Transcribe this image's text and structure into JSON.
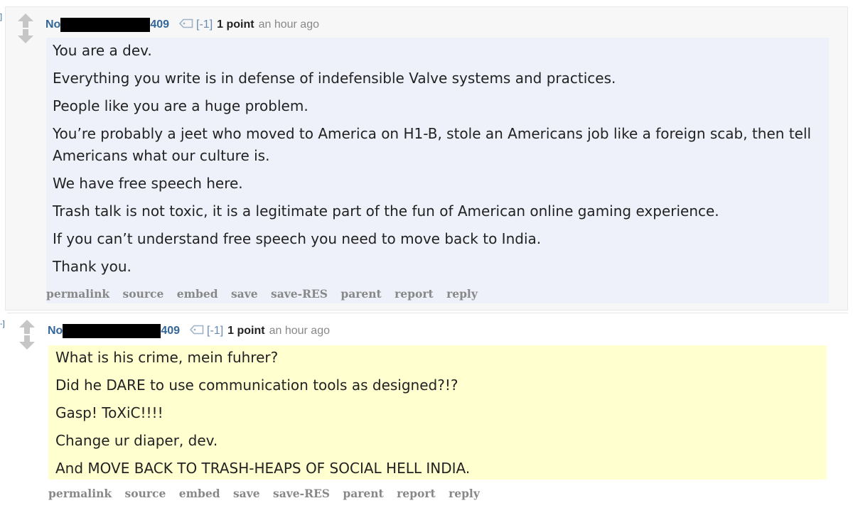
{
  "comments": [
    {
      "gutter": "]",
      "author_prefix": "No",
      "author_suffix": "409",
      "flair": "[-1]",
      "score": "1 point",
      "time": "an hour ago",
      "paragraphs": [
        "You are a dev.",
        "Everything you write is in defense of indefensible Valve systems and practices.",
        "People like you are a huge problem.",
        "You’re probably a jeet who moved to America on H1-B, stole an Americans job like a foreign scab, then tell Americans what our culture is.",
        "We have free speech here.",
        "Trash talk is not toxic, it is a  legitimate part of the fun of American online gaming experience.",
        "If you can’t understand free speech you need to move back to India.",
        "Thank you."
      ],
      "buttons": [
        "permalink",
        "source",
        "embed",
        "save",
        "save-RES",
        "parent",
        "report",
        "reply"
      ],
      "body_bg": "#eef1f9"
    },
    {
      "gutter": "-]",
      "author_prefix": "No",
      "author_suffix": "409",
      "flair": "[-1]",
      "score": "1 point",
      "time": "an hour ago",
      "paragraphs": [
        "What is his crime, mein fuhrer?",
        "Did he DARE to use communication tools as designed?!?",
        "Gasp! ToXiC!!!!",
        "Change ur diaper, dev.",
        "And MOVE BACK TO TRASH-HEAPS OF SOCIAL HELL INDIA."
      ],
      "buttons": [
        "permalink",
        "source",
        "embed",
        "save",
        "save-RES",
        "parent",
        "report",
        "reply"
      ],
      "body_bg": "#ffffcf"
    }
  ],
  "icons": [
    "upvote-arrow-icon",
    "downvote-arrow-icon",
    "tag-icon"
  ],
  "colors": {
    "author": "#336699",
    "muted": "#888888",
    "text": "#222222"
  }
}
